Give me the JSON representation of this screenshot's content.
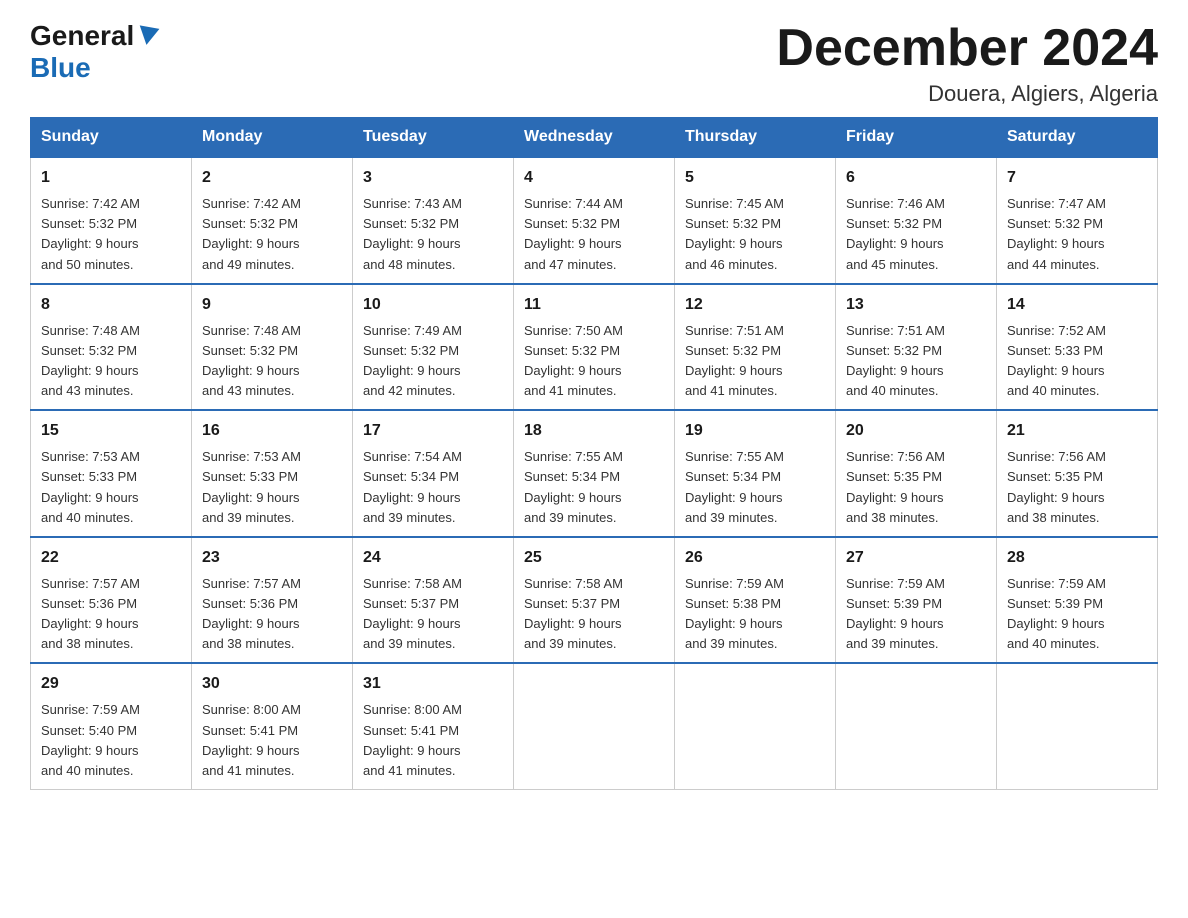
{
  "logo": {
    "general": "General",
    "blue": "Blue"
  },
  "title": "December 2024",
  "location": "Douera, Algiers, Algeria",
  "days_of_week": [
    "Sunday",
    "Monday",
    "Tuesday",
    "Wednesday",
    "Thursday",
    "Friday",
    "Saturday"
  ],
  "weeks": [
    [
      {
        "day": "1",
        "sunrise": "7:42 AM",
        "sunset": "5:32 PM",
        "daylight": "9 hours and 50 minutes."
      },
      {
        "day": "2",
        "sunrise": "7:42 AM",
        "sunset": "5:32 PM",
        "daylight": "9 hours and 49 minutes."
      },
      {
        "day": "3",
        "sunrise": "7:43 AM",
        "sunset": "5:32 PM",
        "daylight": "9 hours and 48 minutes."
      },
      {
        "day": "4",
        "sunrise": "7:44 AM",
        "sunset": "5:32 PM",
        "daylight": "9 hours and 47 minutes."
      },
      {
        "day": "5",
        "sunrise": "7:45 AM",
        "sunset": "5:32 PM",
        "daylight": "9 hours and 46 minutes."
      },
      {
        "day": "6",
        "sunrise": "7:46 AM",
        "sunset": "5:32 PM",
        "daylight": "9 hours and 45 minutes."
      },
      {
        "day": "7",
        "sunrise": "7:47 AM",
        "sunset": "5:32 PM",
        "daylight": "9 hours and 44 minutes."
      }
    ],
    [
      {
        "day": "8",
        "sunrise": "7:48 AM",
        "sunset": "5:32 PM",
        "daylight": "9 hours and 43 minutes."
      },
      {
        "day": "9",
        "sunrise": "7:48 AM",
        "sunset": "5:32 PM",
        "daylight": "9 hours and 43 minutes."
      },
      {
        "day": "10",
        "sunrise": "7:49 AM",
        "sunset": "5:32 PM",
        "daylight": "9 hours and 42 minutes."
      },
      {
        "day": "11",
        "sunrise": "7:50 AM",
        "sunset": "5:32 PM",
        "daylight": "9 hours and 41 minutes."
      },
      {
        "day": "12",
        "sunrise": "7:51 AM",
        "sunset": "5:32 PM",
        "daylight": "9 hours and 41 minutes."
      },
      {
        "day": "13",
        "sunrise": "7:51 AM",
        "sunset": "5:32 PM",
        "daylight": "9 hours and 40 minutes."
      },
      {
        "day": "14",
        "sunrise": "7:52 AM",
        "sunset": "5:33 PM",
        "daylight": "9 hours and 40 minutes."
      }
    ],
    [
      {
        "day": "15",
        "sunrise": "7:53 AM",
        "sunset": "5:33 PM",
        "daylight": "9 hours and 40 minutes."
      },
      {
        "day": "16",
        "sunrise": "7:53 AM",
        "sunset": "5:33 PM",
        "daylight": "9 hours and 39 minutes."
      },
      {
        "day": "17",
        "sunrise": "7:54 AM",
        "sunset": "5:34 PM",
        "daylight": "9 hours and 39 minutes."
      },
      {
        "day": "18",
        "sunrise": "7:55 AM",
        "sunset": "5:34 PM",
        "daylight": "9 hours and 39 minutes."
      },
      {
        "day": "19",
        "sunrise": "7:55 AM",
        "sunset": "5:34 PM",
        "daylight": "9 hours and 39 minutes."
      },
      {
        "day": "20",
        "sunrise": "7:56 AM",
        "sunset": "5:35 PM",
        "daylight": "9 hours and 38 minutes."
      },
      {
        "day": "21",
        "sunrise": "7:56 AM",
        "sunset": "5:35 PM",
        "daylight": "9 hours and 38 minutes."
      }
    ],
    [
      {
        "day": "22",
        "sunrise": "7:57 AM",
        "sunset": "5:36 PM",
        "daylight": "9 hours and 38 minutes."
      },
      {
        "day": "23",
        "sunrise": "7:57 AM",
        "sunset": "5:36 PM",
        "daylight": "9 hours and 38 minutes."
      },
      {
        "day": "24",
        "sunrise": "7:58 AM",
        "sunset": "5:37 PM",
        "daylight": "9 hours and 39 minutes."
      },
      {
        "day": "25",
        "sunrise": "7:58 AM",
        "sunset": "5:37 PM",
        "daylight": "9 hours and 39 minutes."
      },
      {
        "day": "26",
        "sunrise": "7:59 AM",
        "sunset": "5:38 PM",
        "daylight": "9 hours and 39 minutes."
      },
      {
        "day": "27",
        "sunrise": "7:59 AM",
        "sunset": "5:39 PM",
        "daylight": "9 hours and 39 minutes."
      },
      {
        "day": "28",
        "sunrise": "7:59 AM",
        "sunset": "5:39 PM",
        "daylight": "9 hours and 40 minutes."
      }
    ],
    [
      {
        "day": "29",
        "sunrise": "7:59 AM",
        "sunset": "5:40 PM",
        "daylight": "9 hours and 40 minutes."
      },
      {
        "day": "30",
        "sunrise": "8:00 AM",
        "sunset": "5:41 PM",
        "daylight": "9 hours and 41 minutes."
      },
      {
        "day": "31",
        "sunrise": "8:00 AM",
        "sunset": "5:41 PM",
        "daylight": "9 hours and 41 minutes."
      },
      null,
      null,
      null,
      null
    ]
  ],
  "labels": {
    "sunrise": "Sunrise:",
    "sunset": "Sunset:",
    "daylight": "Daylight:"
  }
}
